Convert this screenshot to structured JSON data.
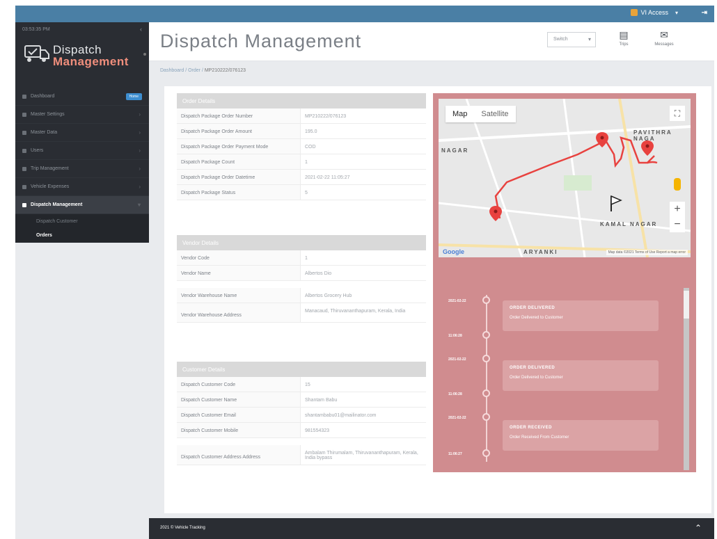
{
  "topbar": {
    "user_label": "VI Access",
    "logout": "⇥"
  },
  "sidebar": {
    "clock": "03:53:35 PM",
    "logo_line1": "Dispatch",
    "logo_line2": "Management",
    "items": [
      {
        "label": "Dashboard",
        "badge": "Home"
      },
      {
        "label": "Master Settings"
      },
      {
        "label": "Master Data"
      },
      {
        "label": "Users"
      },
      {
        "label": "Trip Management"
      },
      {
        "label": "Vehicle Expenses"
      },
      {
        "label": "Dispatch Management"
      }
    ],
    "sub_items": [
      {
        "label": "Dispatch Customer"
      },
      {
        "label": "Orders"
      }
    ]
  },
  "header": {
    "title": "Dispatch Management",
    "select_value": "Switch",
    "btn_trips": "Trips",
    "btn_messages": "Messages"
  },
  "breadcrumb": {
    "home": "Dashboard",
    "sep1": " / ",
    "mid": "Order",
    "sep2": " / ",
    "current": "MP210222/076123"
  },
  "order_details": {
    "heading": "Order Details",
    "rows": [
      {
        "k": "Dispatch Package Order Number",
        "v": "MP210222/076123"
      },
      {
        "k": "Dispatch Package Order Amount",
        "v": "195.0"
      },
      {
        "k": "Dispatch Package Order Payment Mode",
        "v": "COD"
      },
      {
        "k": "Dispatch Package Count",
        "v": "1"
      },
      {
        "k": "Dispatch Package Order Datetime",
        "v": "2021-02-22 11:05:27"
      },
      {
        "k": "Dispatch Package Status",
        "v": "5"
      }
    ]
  },
  "vendor_details": {
    "heading": "Vendor Details",
    "rows": [
      {
        "k": "Vendor Code",
        "v": "1"
      },
      {
        "k": "Vendor Name",
        "v": "Albertos Dio"
      },
      {
        "k": "Vendor Warehouse Name",
        "v": "Albertos Grocery Hub"
      },
      {
        "k": "Vendor Warehouse Address",
        "v": "Manacaud, Thiruvananthapuram, Kerala, India"
      }
    ]
  },
  "customer_details": {
    "heading": "Customer Details",
    "rows": [
      {
        "k": "Dispatch Customer Code",
        "v": "15"
      },
      {
        "k": "Dispatch Customer Name",
        "v": "Shantam Babu"
      },
      {
        "k": "Dispatch Customer Email",
        "v": "shantambabu01@mailinator.com"
      },
      {
        "k": "Dispatch Customer Mobile",
        "v": "981554323"
      },
      {
        "k": "Dispatch Customer Address Address",
        "v": "Ambalam Thirumalam, Thiruvananthapuram, Kerala, India bypass"
      }
    ]
  },
  "map": {
    "tab_map": "Map",
    "tab_satellite": "Satellite",
    "google": "Google",
    "attribution": "Map data ©2021 Terms of Use Report a map error",
    "labels": {
      "pavithra": "PAVITHRA NAGA",
      "nagar": "NAGAR",
      "kamal": "KAMAL NAGAR",
      "aryanki": "ARYANKI"
    },
    "zoom_in": "+",
    "zoom_out": "−",
    "fullscreen": "⛶"
  },
  "timeline": {
    "events": [
      {
        "date": "2021-02-22",
        "time": "11:06:28",
        "title": "ORDER DELIVERED",
        "desc": "Order Delivered to Customer"
      },
      {
        "date": "2021-02-22",
        "time": "11:06:28",
        "title": "ORDER DELIVERED",
        "desc": "Order Delivered to Customer"
      },
      {
        "date": "2021-02-22",
        "time": "11:06:27",
        "title": "ORDER RECEIVED",
        "desc": "Order Received From Customer"
      }
    ]
  },
  "footer": {
    "text": "2021 © Vehicle Tracking",
    "up": "⌃"
  },
  "colors": {
    "sidebar_bg": "#2a2d33",
    "topbar_bg": "#4a7fa5",
    "map_panel": "#d08c8f",
    "route": "#e8423f"
  }
}
